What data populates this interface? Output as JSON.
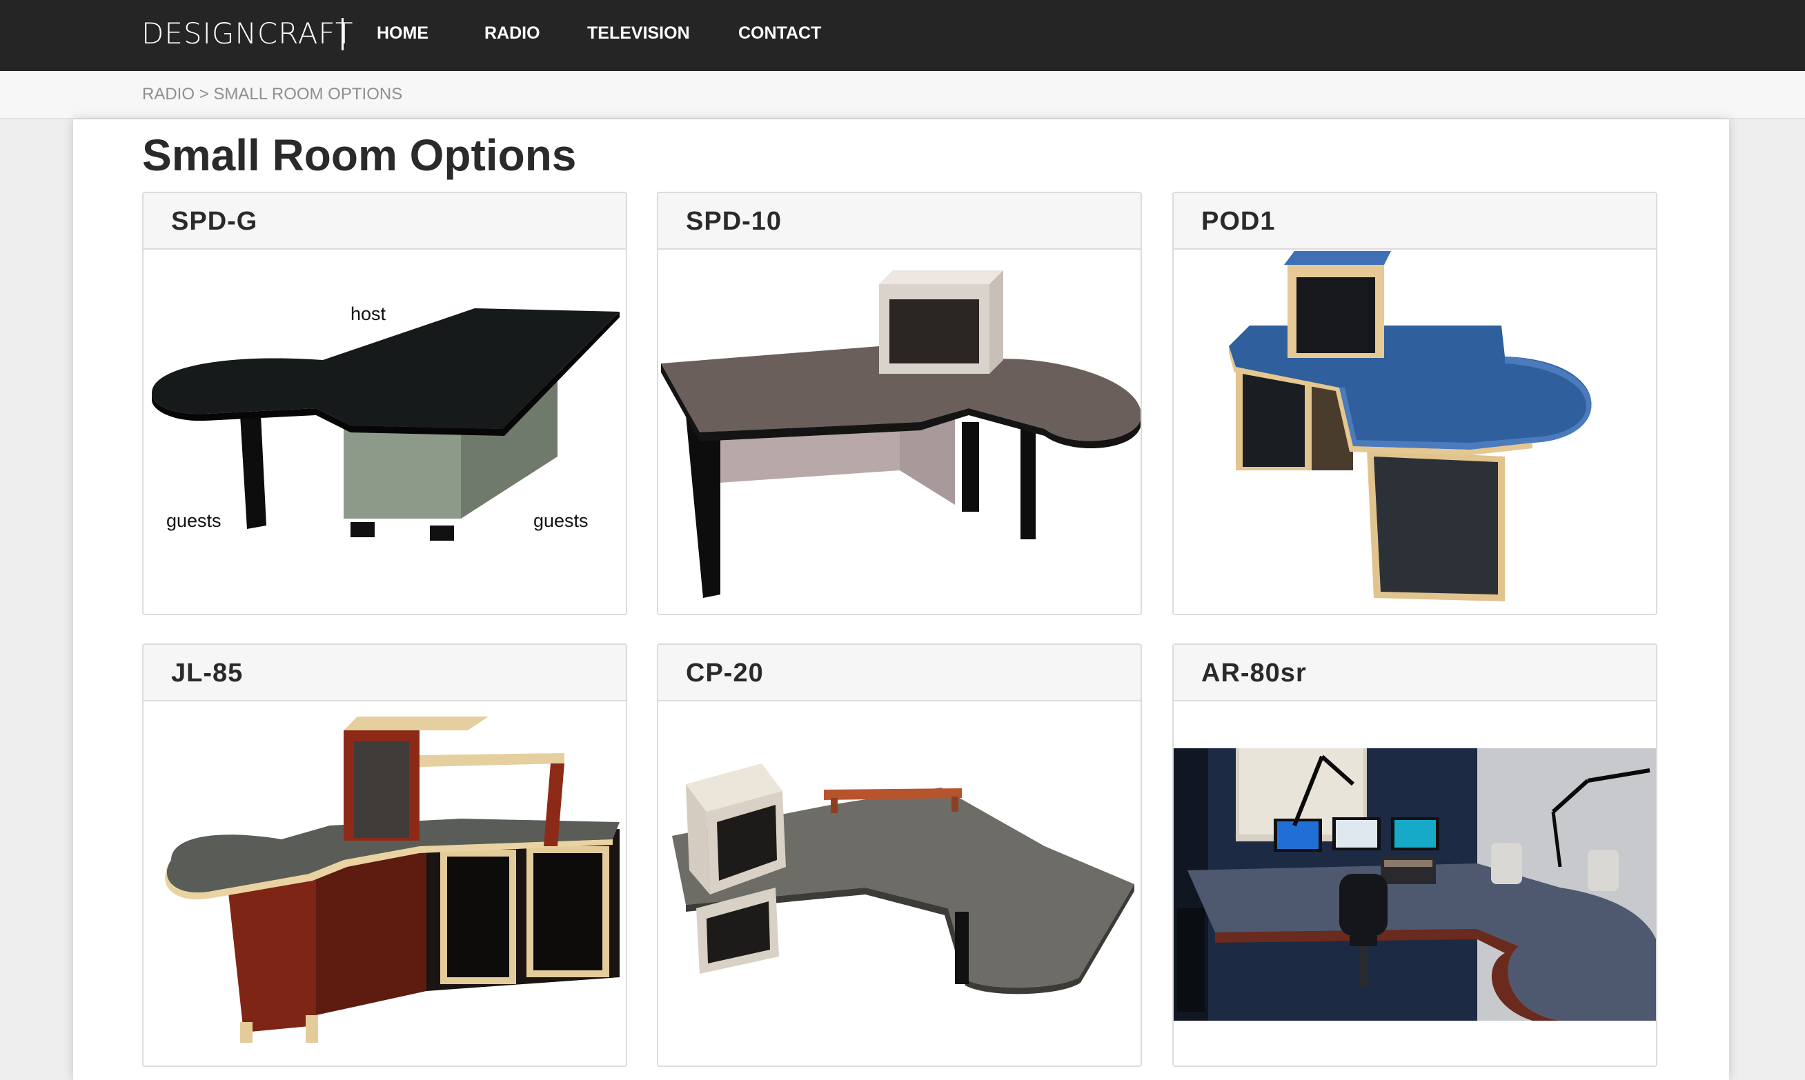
{
  "brand": {
    "logo_text": "DESIGNCRAFT"
  },
  "nav": {
    "items": [
      {
        "label": "HOME"
      },
      {
        "label": "RADIO"
      },
      {
        "label": "TELEVISION"
      },
      {
        "label": "CONTACT"
      }
    ]
  },
  "breadcrumb": {
    "parent": "RADIO",
    "separator": ">",
    "current": "SMALL ROOM OPTIONS"
  },
  "page": {
    "title": "Small Room Options"
  },
  "products": [
    {
      "name": "SPD-G",
      "image_labels": [
        "host",
        "guests",
        "guests"
      ]
    },
    {
      "name": "SPD-10"
    },
    {
      "name": "POD1"
    },
    {
      "name": "JL-85"
    },
    {
      "name": "CP-20"
    },
    {
      "name": "AR-80sr"
    }
  ],
  "colors": {
    "nav_bg": "#252525",
    "breadcrumb_text": "#8f8f8f",
    "card_header_bg": "#f6f6f6"
  }
}
